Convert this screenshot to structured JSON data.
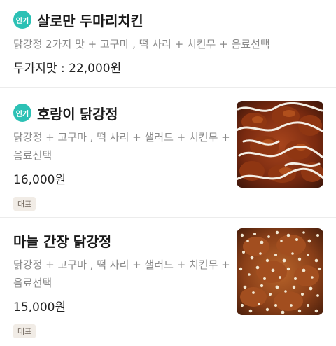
{
  "menu": {
    "items": [
      {
        "badge": "인기",
        "title": "살로만 두마리치킨",
        "description": "닭강정 2가지 맛 + 고구마 , 떡 사리  + 치킨무 + 음료선택",
        "price": "두가지맛 : 22,000원"
      },
      {
        "badge": "인기",
        "title": "호랑이 닭강정",
        "description": "닭강정 + 고구마 , 떡 사리 + 샐러드 + 치킨무 + 음료선택",
        "price": "16,000원",
        "tag": "대표",
        "image": "tiger-dakgangjeong-photo"
      },
      {
        "title": "마늘 간장 닭강정",
        "description": "닭강정 + 고구마 , 떡 사리 + 샐러드 + 치킨무 + 음료선택",
        "price": "15,000원",
        "tag": "대표",
        "image": "garlic-soy-dakgangjeong-photo"
      }
    ]
  },
  "colors": {
    "popular_badge": "#2cc1b5",
    "tag_background": "#f1ece6",
    "description_text": "#8a8a8a"
  }
}
